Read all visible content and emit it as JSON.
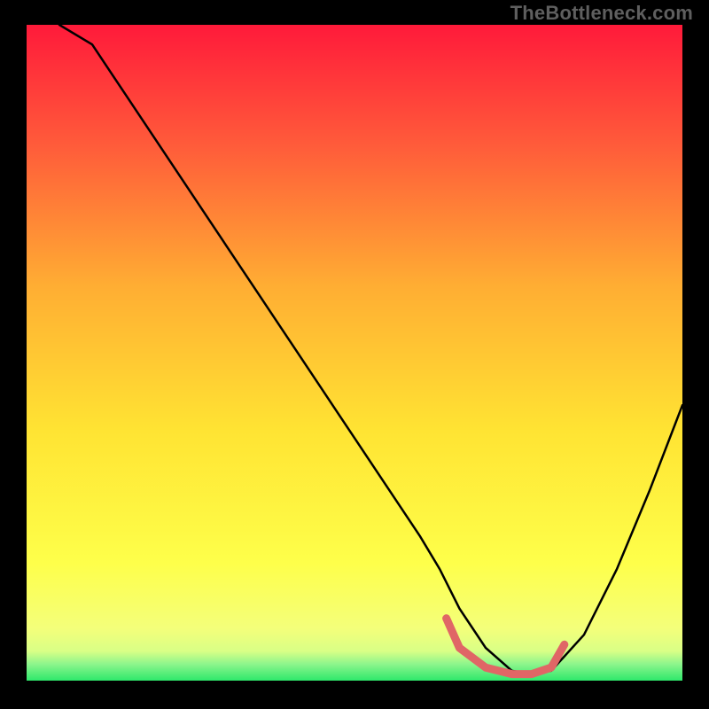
{
  "watermark": "TheBottleneck.com",
  "chart_data": {
    "type": "line",
    "title": "",
    "xlabel": "",
    "ylabel": "",
    "xlim": [
      0,
      100
    ],
    "ylim": [
      0,
      100
    ],
    "grid": false,
    "series": [
      {
        "name": "curve",
        "color": "#000000",
        "x": [
          5,
          10,
          15,
          20,
          25,
          30,
          35,
          40,
          45,
          50,
          55,
          60,
          63,
          66,
          70,
          74,
          77,
          80,
          85,
          90,
          95,
          100
        ],
        "y": [
          100,
          97,
          89.5,
          82,
          74.5,
          67,
          59.5,
          52,
          44.5,
          37,
          29.5,
          22,
          17,
          11,
          5,
          1.5,
          1,
          1.5,
          7,
          17,
          29,
          42
        ]
      },
      {
        "name": "trough-highlight",
        "color": "#e06666",
        "x": [
          64,
          66,
          70,
          74,
          77,
          80,
          82
        ],
        "y": [
          9.5,
          5,
          2,
          1,
          1,
          2,
          5.5
        ]
      }
    ],
    "gradient_stops": [
      {
        "offset": 0.0,
        "color": "#ff1a3a"
      },
      {
        "offset": 0.18,
        "color": "#ff5a3a"
      },
      {
        "offset": 0.4,
        "color": "#ffae33"
      },
      {
        "offset": 0.62,
        "color": "#ffe433"
      },
      {
        "offset": 0.82,
        "color": "#feff4a"
      },
      {
        "offset": 0.92,
        "color": "#f4ff7a"
      },
      {
        "offset": 0.955,
        "color": "#d9ff86"
      },
      {
        "offset": 0.975,
        "color": "#8cf58c"
      },
      {
        "offset": 1.0,
        "color": "#2ee86b"
      }
    ]
  }
}
